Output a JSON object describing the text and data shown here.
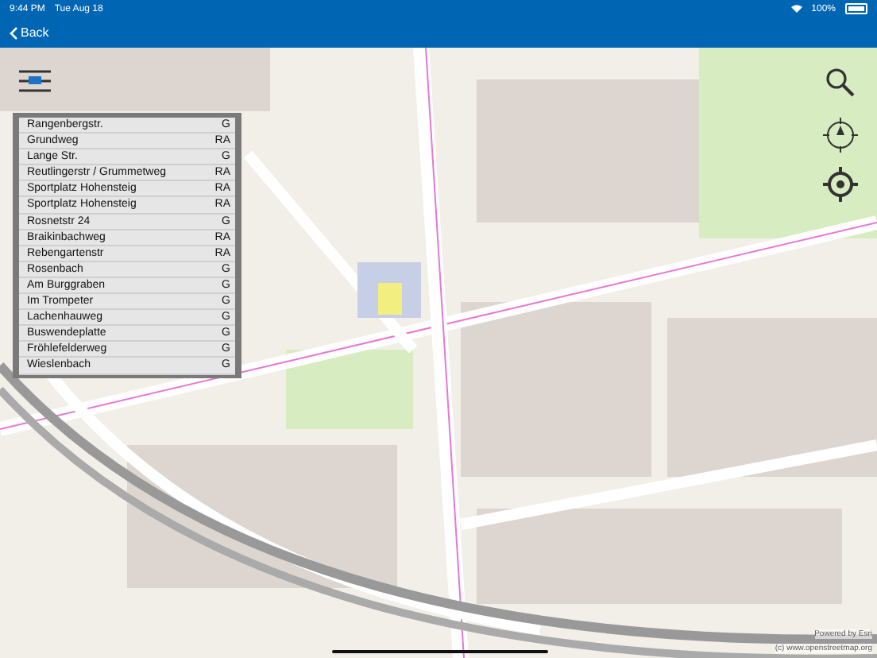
{
  "status_bar": {
    "time": "9:44 PM",
    "date": "Tue Aug 18",
    "battery": "100%"
  },
  "nav": {
    "back": "Back"
  },
  "list": [
    {
      "name": "Rangenbergstr.",
      "code": "G"
    },
    {
      "name": "Grundweg",
      "code": "RA"
    },
    {
      "name": "Lange Str.",
      "code": "G"
    },
    {
      "name": "Reutlingerstr / Grummetweg",
      "code": "RA"
    },
    {
      "name": "Sportplatz Hohensteig",
      "code": "RA"
    },
    {
      "name": "Sportplatz Hohensteig",
      "code": "RA"
    },
    {
      "name": "Rosnetstr 24",
      "code": "G"
    },
    {
      "name": "Braikinbachweg",
      "code": "RA"
    },
    {
      "name": "Rebengartenstr",
      "code": "RA"
    },
    {
      "name": "Rosenbach",
      "code": "G"
    },
    {
      "name": "Am Burggraben",
      "code": "G"
    },
    {
      "name": "Im Trompeter",
      "code": "G"
    },
    {
      "name": "Lachenhauweg",
      "code": "G"
    },
    {
      "name": "Buswendeplatte",
      "code": "G"
    },
    {
      "name": "Fröhlefelderweg",
      "code": "G"
    },
    {
      "name": "Wieslenbach",
      "code": "G"
    }
  ],
  "attribution": {
    "powered": "Powered by Esri",
    "copyright": "(c) www.openstreetmap.org"
  }
}
